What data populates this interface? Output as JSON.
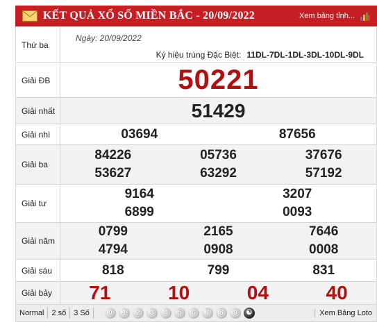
{
  "header": {
    "title": "KẾT QUẢ XỔ SỐ MIỀN BẮC - 20/09/2022",
    "link": "Xem bảng tỉnh...",
    "mail_icon": "envelope-icon",
    "chart_icon": "bar-chart-icon"
  },
  "info": {
    "weekday": "Thứ ba",
    "date": "Ngày: 20/09/2022",
    "ky_hieu_label": "Ký hiệu trúng Đặc Biệt:",
    "ky_hieu_value": "11DL-7DL-1DL-3DL-10DL-9DL"
  },
  "prizes": {
    "db": {
      "label": "Giải ĐB",
      "numbers": [
        "50221"
      ]
    },
    "nhat": {
      "label": "Giải nhất",
      "numbers": [
        "51429"
      ]
    },
    "nhi": {
      "label": "Giải nhì",
      "numbers": [
        "03694",
        "87656"
      ]
    },
    "ba": {
      "label": "Giải ba",
      "numbers": [
        "84226",
        "05736",
        "37676",
        "53627",
        "63292",
        "57192"
      ]
    },
    "tu": {
      "label": "Giải tư",
      "numbers": [
        "9164",
        "3207",
        "6899",
        "0093"
      ]
    },
    "nam": {
      "label": "Giải năm",
      "numbers": [
        "0799",
        "2165",
        "7646",
        "4794",
        "0908",
        "0008"
      ]
    },
    "sau": {
      "label": "Giải sáu",
      "numbers": [
        "818",
        "799",
        "831"
      ]
    },
    "bay": {
      "label": "Giải bảy",
      "numbers": [
        "71",
        "10",
        "04",
        "40"
      ]
    }
  },
  "footer": {
    "options": [
      "Normal",
      "2 số",
      "3 Số"
    ],
    "digits": [
      "0",
      "1",
      "2",
      "3",
      "4",
      "5",
      "6",
      "7",
      "8",
      "9"
    ],
    "loto_link": "Xem Bảng Loto"
  },
  "colors": {
    "header_bg": "#c51e23",
    "special_red": "#b30f0f"
  }
}
